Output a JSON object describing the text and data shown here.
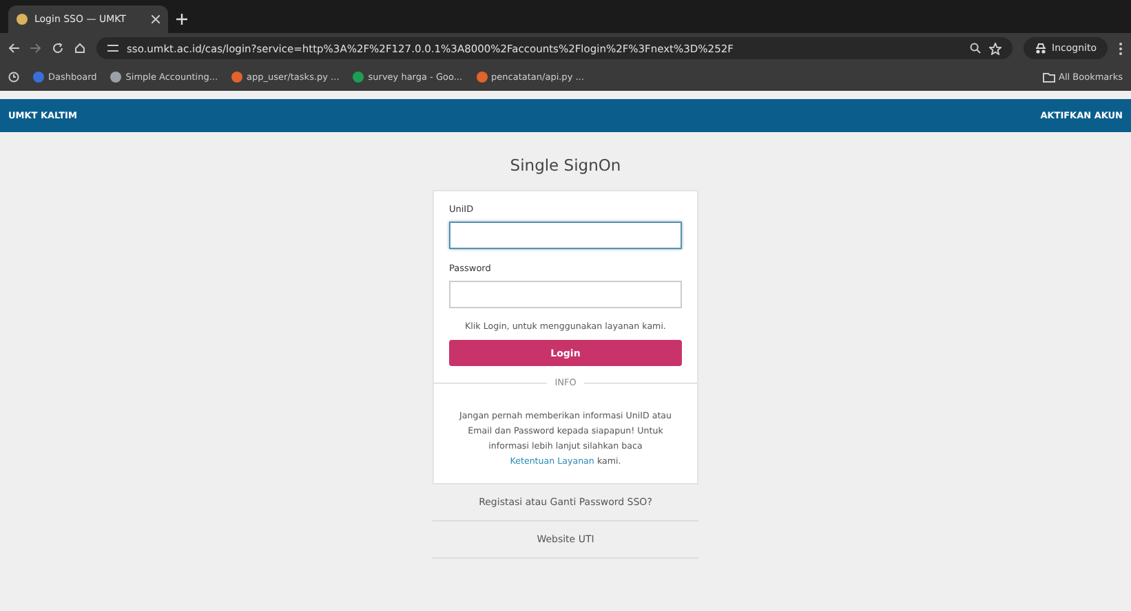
{
  "browser": {
    "tabs": [
      {
        "title": "Login SSO — UMKT",
        "selected": true
      }
    ],
    "url": "sso.umkt.ac.id/cas/login?service=http%3A%2F%2F127.0.0.1%3A8000%2Faccounts%2Flogin%2F%3Fnext%3D%252F",
    "profile": "Incognito",
    "bookmarks": [
      {
        "label": "Dashboard",
        "color": "#3b6fd8"
      },
      {
        "label": "Simple Accounting...",
        "color": "#9aa0a6"
      },
      {
        "label": "app_user/tasks.py ...",
        "color": "#e2632b"
      },
      {
        "label": "survey harga - Goo...",
        "color": "#1e9e55"
      },
      {
        "label": "pencatatan/api.py ...",
        "color": "#e2632b"
      }
    ],
    "all_bookmarks": "All Bookmarks"
  },
  "navbar": {
    "brand": "UMKT KALTIM",
    "action": "AKTIFKAN AKUN"
  },
  "title": "Single SignOn",
  "form": {
    "fields": [
      {
        "label": "UniID",
        "focused": true
      },
      {
        "label": "Password",
        "focused": false
      }
    ],
    "hint": "Klik Login, untuk menggunakan layanan kami.",
    "button": "Login",
    "divider": "INFO",
    "info": {
      "before": "Jangan pernah memberikan informasi UniID atau Email dan Password kepada siapapun! Untuk informasi lebih lanjut silahkan baca",
      "link": "Ketentuan Layanan",
      "after": "kami."
    }
  },
  "links": [
    "Registasi atau Ganti Password SSO?",
    "Website UTI"
  ]
}
